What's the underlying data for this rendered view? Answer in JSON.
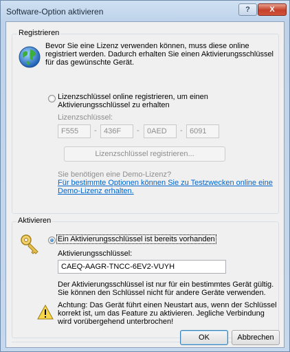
{
  "window": {
    "title": "Software-Option aktivieren",
    "help_label": "?",
    "close_label": "X"
  },
  "registrieren": {
    "group_title": "Registrieren",
    "intro_line1": "Bevor Sie eine Lizenz verwenden können, muss diese online",
    "intro_line2": "registriert werden. Dadurch erhalten Sie einen Aktivierungsschlüssel",
    "intro_line3": "für das gewünschte Gerät.",
    "radio_line1": "Lizenzschlüssel online registrieren, um einen",
    "radio_line2": "Aktivierungsschlüssel zu erhalten",
    "key_label": "Lizenzschlüssel:",
    "key_parts": [
      "F555",
      "436F",
      "0AED",
      "6091"
    ],
    "key_separator": "-",
    "register_button": "Lizenzschlüssel registrieren...",
    "demo_question": "Sie benötigen eine Demo-Lizenz?",
    "demo_link_line1": "Für bestimmte Optionen können Sie zu Testzwecken online eine",
    "demo_link_line2": "Demo-Lizenz erhalten."
  },
  "aktivieren": {
    "group_title": "Aktivieren",
    "radio_label": "Ein Aktivierungsschlüssel ist bereits vorhanden",
    "activation_key_label": "Aktivierungsschlüssel:",
    "activation_key_value": "CAEQ-AAGR-TNCC-6EV2-VUYH",
    "info_line1": "Der Aktivierungsschlüssel ist nur für ein bestimmtes Gerät gültig.",
    "info_line2": "Sie können den Schlüssel nicht für andere Geräte verwenden.",
    "warning_line1": "Achtung: Das Gerät führt einen Neustart aus, wenn der Schlüssel",
    "warning_line2": "korrekt ist, um das Feature zu aktivieren. Jegliche Verbindung",
    "warning_line3": "wird vorübergehend unterbrochen!"
  },
  "footer": {
    "ok_label": "OK",
    "cancel_label": "Abbrechen"
  },
  "colors": {
    "link": "#0066cc",
    "disabled_text": "#8d8d8d",
    "titlebar": "#c5d8ed"
  }
}
